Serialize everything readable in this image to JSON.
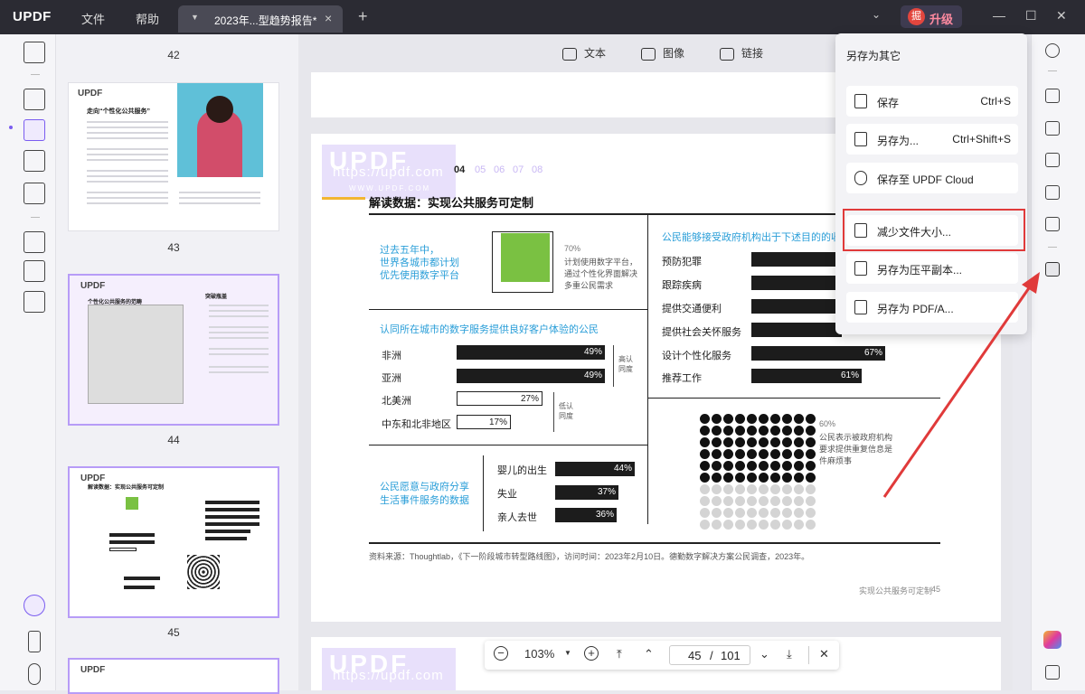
{
  "titlebar": {
    "logo": "UPDF",
    "menu": [
      "文件",
      "帮助"
    ],
    "tab_title": "2023年...型趋势报告*",
    "tab_close": "×",
    "new_tab": "+",
    "upgrade_avatar": "掘",
    "upgrade_label": "升级"
  },
  "thumbnails": {
    "pages": [
      "42",
      "43",
      "44",
      "45"
    ],
    "p43_title": "走向“个性化公共服务”",
    "p44_title": "个性化公共服务的范畴",
    "p44_side_title": "突破瓶盖",
    "p45_title": "解读数据：实现公共服务可定制"
  },
  "doc_toolbar": {
    "text": "文本",
    "image": "图像",
    "link": "链接"
  },
  "page": {
    "watermark": "UPDF",
    "watermark_url": "https://updf.com",
    "watermark_url2": "WWW.UPDF.COM",
    "page_nums": [
      "04",
      "05",
      "06",
      "07",
      "08"
    ],
    "heading": "解读数据：实现公共服务可定制",
    "section1_blue": "过去五年中，\n世界各城市都计划\n优先使用数字平台",
    "section1_pct": "70%",
    "section1_desc": "计划使用数字平台，\n通过个性化界面解决\n多重公民需求",
    "section2_blue": "认同所在城市的数字服务提供良好客户体验的公民",
    "section2_rows": [
      {
        "label": "非洲",
        "value": "49%"
      },
      {
        "label": "亚洲",
        "value": "49%"
      },
      {
        "label": "北美洲",
        "value": "27%"
      },
      {
        "label": "中东和北非地区",
        "value": "17%"
      }
    ],
    "section2_high": "高认同度",
    "section2_low": "低认同度",
    "section3_blue": "公民愿意与政府分享\n生活事件服务的数据",
    "section3_rows": [
      {
        "label": "婴儿的出生",
        "value": "44%"
      },
      {
        "label": "失业",
        "value": "37%"
      },
      {
        "label": "亲人去世",
        "value": "36%"
      }
    ],
    "section4_blue": "公民能够接受政府机构出于下述目的的收集",
    "section4_rows": [
      {
        "label": "预防犯罪",
        "value": ""
      },
      {
        "label": "跟踪疾病",
        "value": ""
      },
      {
        "label": "提供交通便利",
        "value": ""
      },
      {
        "label": "提供社会关怀服务",
        "value": ""
      },
      {
        "label": "设计个性化服务",
        "value": "67%"
      },
      {
        "label": "推荐工作",
        "value": "61%"
      }
    ],
    "section5_pct": "60%",
    "section5_desc": "公民表示被政府机构\n要求提供重复信息是\n件麻烦事",
    "source": "资料来源：Thoughtlab，《下一阶段城市转型路线图》，访问时间：2023年2月10日。德勤数字解决方案公民调查，2023年。",
    "footer_text": "实现公共服务可定制",
    "footer_num": "45"
  },
  "popup": {
    "title": "另存为其它",
    "items": [
      {
        "label": "保存",
        "shortcut": "Ctrl+S"
      },
      {
        "label": "另存为...",
        "shortcut": "Ctrl+Shift+S"
      },
      {
        "label": "保存至 UPDF Cloud",
        "shortcut": ""
      },
      {
        "label": "减少文件大小...",
        "shortcut": ""
      },
      {
        "label": "另存为压平副本...",
        "shortcut": ""
      },
      {
        "label": "另存为 PDF/A...",
        "shortcut": ""
      }
    ]
  },
  "zoom": {
    "level": "103%",
    "current_page": "45",
    "separator": "/",
    "total_pages": "101"
  },
  "colors": {
    "accent": "#7a5cf0",
    "green": "#7ac142",
    "highlight_red": "#e03a3a",
    "blue_text": "#2a9ed8"
  }
}
